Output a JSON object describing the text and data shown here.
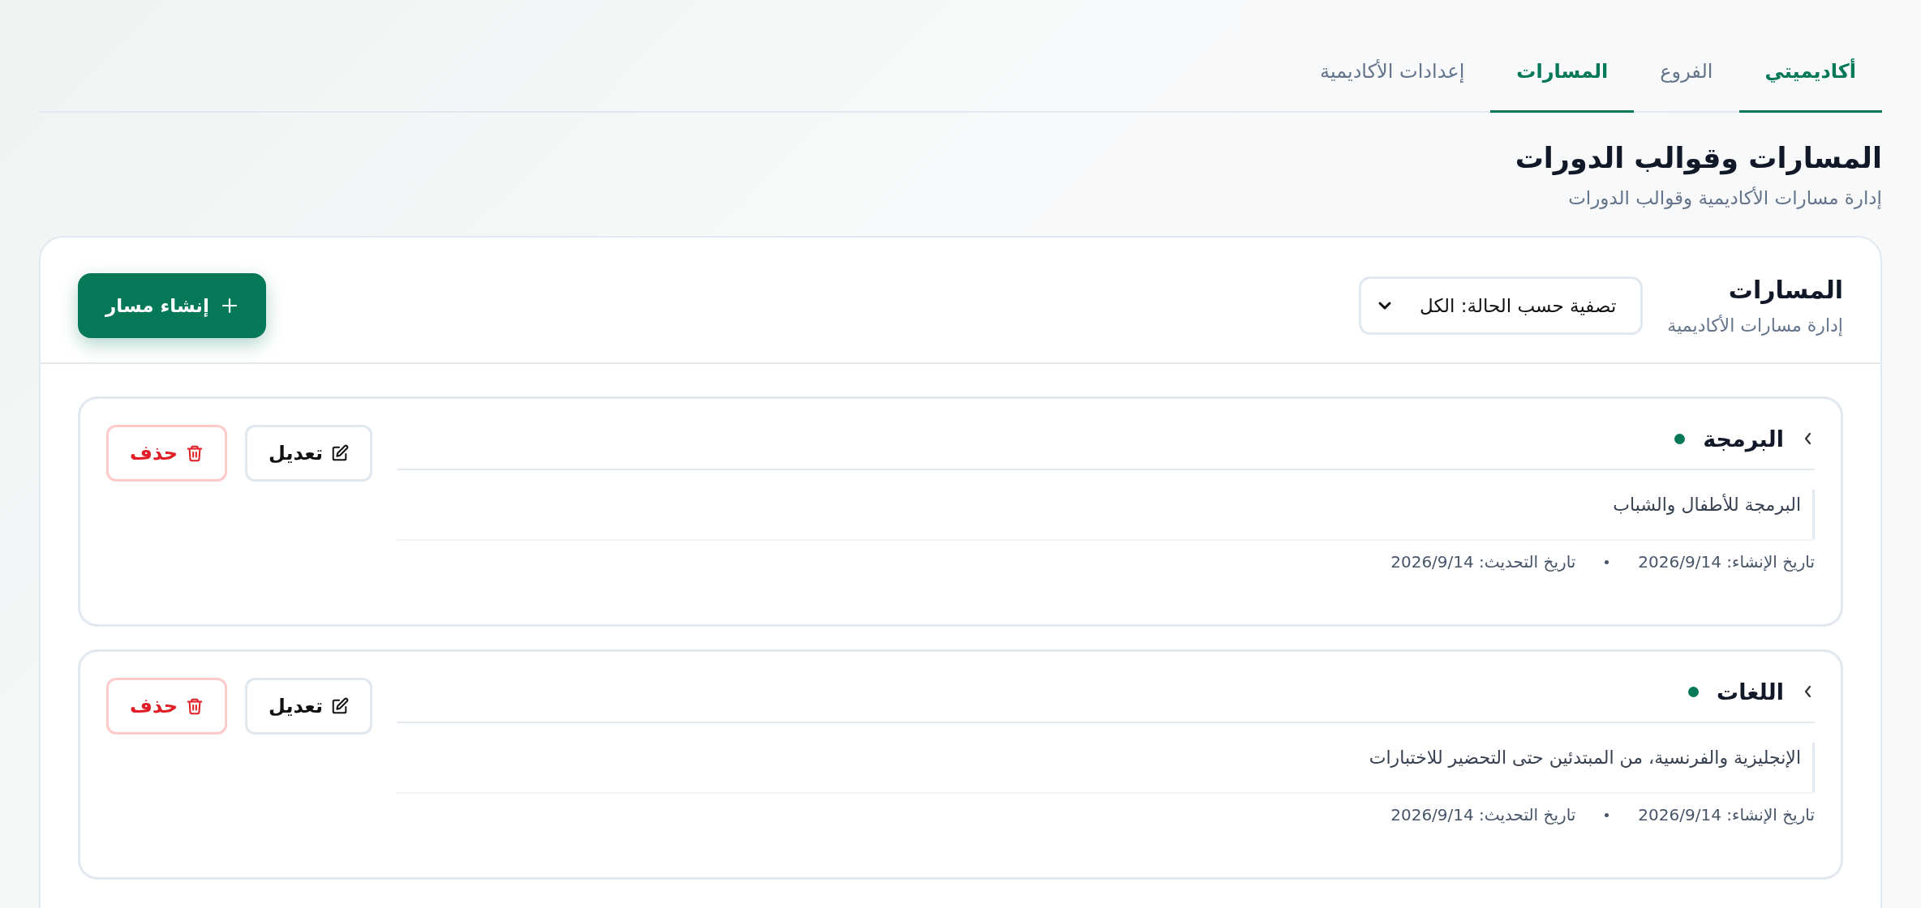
{
  "tabs": [
    {
      "label": "أكاديميتي",
      "selected": true
    },
    {
      "label": "الفروع",
      "selected": false
    },
    {
      "label": "المسارات",
      "selected": true
    },
    {
      "label": "إعدادات الأكاديمية",
      "selected": false
    }
  ],
  "header": {
    "title": "المسارات وقوالب الدورات",
    "subtitle": "إدارة مسارات الأكاديمية وقوالب الدورات"
  },
  "panel": {
    "title": "المسارات",
    "subtitle": "إدارة مسارات الأكاديمية",
    "filter": {
      "value": "تصفية حسب الحالة: الكل"
    },
    "create_button": "إنشاء مسار",
    "tracks": [
      {
        "name": "البرمجة",
        "active": true,
        "expanded": false,
        "description": "البرمجة للأطفال والشباب",
        "created": "تاريخ الإنشاء: 2026/9/14",
        "updated": "تاريخ التحديث: 2026/9/14",
        "edit_button": "تعديل",
        "delete_button": "حذف"
      },
      {
        "name": "اللغات",
        "active": true,
        "expanded": false,
        "description": "الإنجليزية والفرنسية، من المبتدئين حتى التحضير للاختبارات",
        "created": "تاريخ الإنشاء: 2026/9/14",
        "updated": "تاريخ التحديث: 2026/9/14",
        "edit_button": "تعديل",
        "delete_button": "حذف"
      }
    ]
  }
}
